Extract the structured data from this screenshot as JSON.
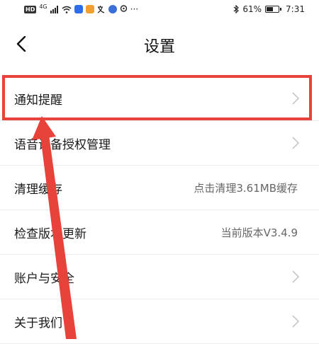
{
  "status_bar": {
    "hd_badge": "HD",
    "network": "4G",
    "battery_text": "61%",
    "battery_level": 0.61,
    "time": "7:31",
    "more": "···"
  },
  "nav": {
    "title": "设置"
  },
  "settings": [
    {
      "label": "通知提醒",
      "value": "",
      "chevron": true
    },
    {
      "label": "语音设备授权管理",
      "value": "",
      "chevron": true
    },
    {
      "label": "清理缓存",
      "value": "点击清理3.61MB缓存",
      "chevron": false
    },
    {
      "label": "检查版本更新",
      "value": "当前版本V3.4.9",
      "chevron": false
    },
    {
      "label": "账户与安全",
      "value": "",
      "chevron": true
    },
    {
      "label": "关于我们",
      "value": "",
      "chevron": true
    }
  ],
  "colors": {
    "annotation": "#e8433a",
    "chevron": "#c8c8c8"
  },
  "icons": {
    "back": "chevron-left-icon",
    "row": "chevron-right-icon"
  }
}
